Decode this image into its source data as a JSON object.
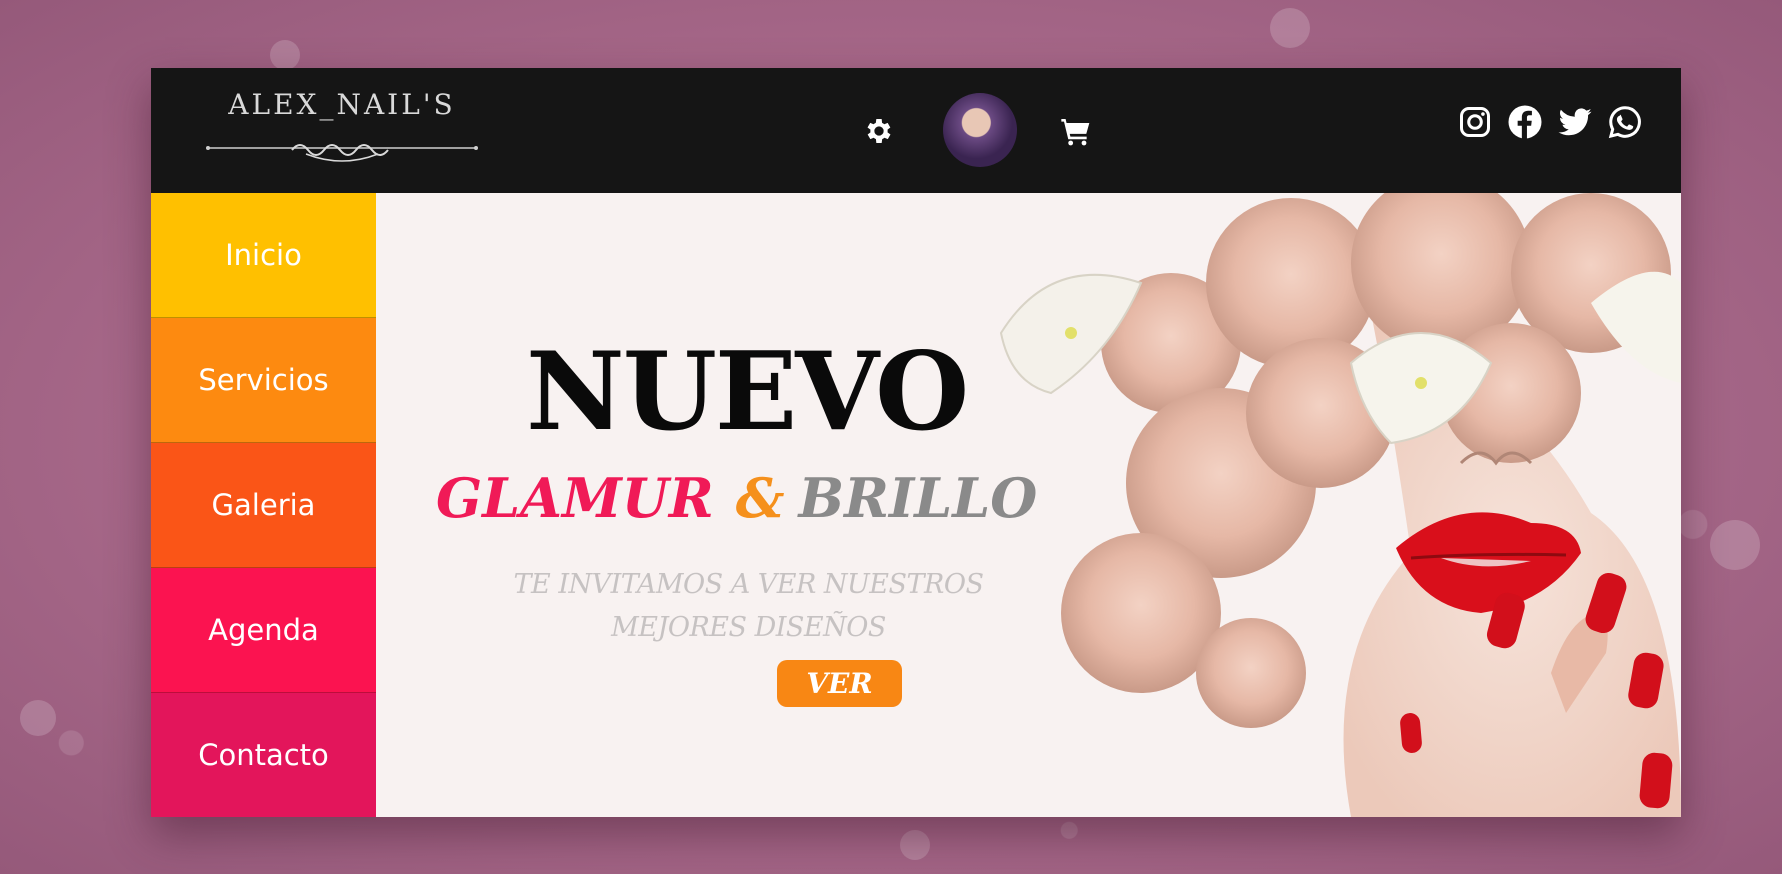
{
  "header": {
    "logo_text": "ALEX_NAIL'S",
    "icons": [
      "gear-icon",
      "avatar",
      "cart-icon"
    ],
    "social": [
      "instagram-icon",
      "facebook-icon",
      "twitter-icon",
      "whatsapp-icon"
    ]
  },
  "sidebar": {
    "items": [
      {
        "label": "Inicio",
        "color": "#ffc000"
      },
      {
        "label": "Servicios",
        "color": "#fd8a10"
      },
      {
        "label": "Galeria",
        "color": "#fa5517"
      },
      {
        "label": "Agenda",
        "color": "#fb1350"
      },
      {
        "label": "Contacto",
        "color": "#e3155b"
      }
    ]
  },
  "hero": {
    "title": "NUEVO",
    "subtitle_part1": "GLAMUR",
    "subtitle_amp": "&",
    "subtitle_part2": "BRILLO",
    "tagline_line1": "TE INVITAMOS A VER NUESTROS",
    "tagline_line2": "MEJORES DISEÑOS",
    "button_label": "VER"
  },
  "colors": {
    "header_bg": "#151515",
    "hero_bg": "#f8f2f1",
    "accent_pink": "#f01a57",
    "accent_orange": "#f88714"
  }
}
